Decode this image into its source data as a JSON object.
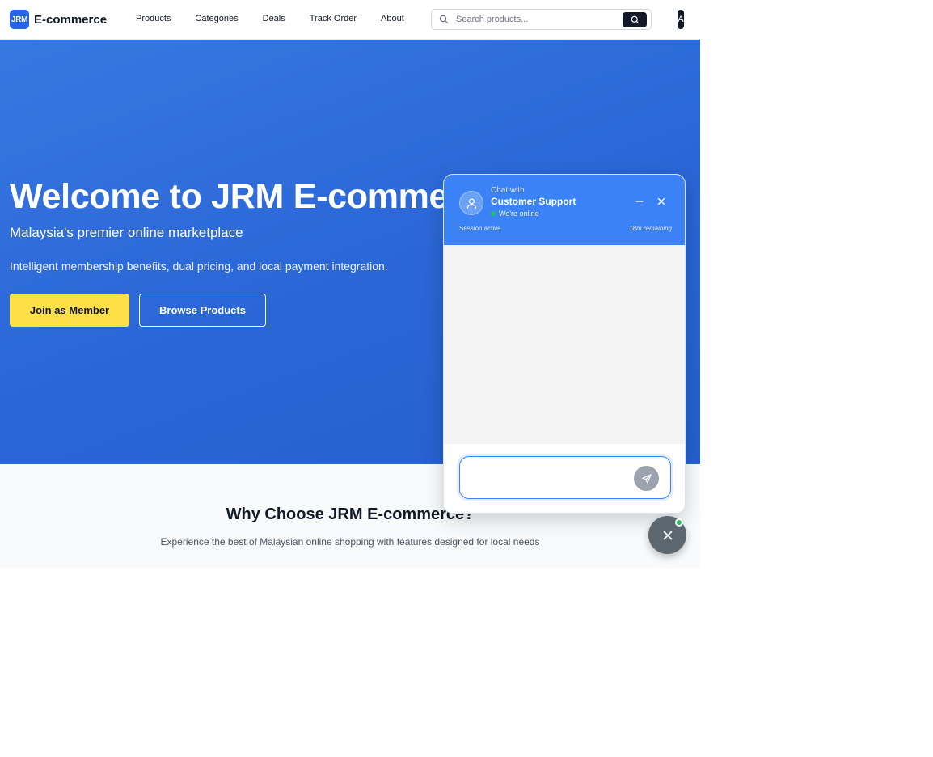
{
  "header": {
    "logo_badge": "JRM",
    "logo_text": "E-commerce",
    "nav": [
      "Products",
      "Categories",
      "Deals",
      "Track Order",
      "About"
    ],
    "search_placeholder": "Search products...",
    "avatar_initial": "A"
  },
  "hero": {
    "title": "Welcome to JRM E-commerce",
    "subtitle": "Malaysia's premier online marketplace",
    "description": "Intelligent membership benefits, dual pricing, and local payment integration.",
    "join_label": "Join as Member",
    "browse_label": "Browse Products"
  },
  "why": {
    "title": "Why Choose JRM E-commerce?",
    "subtitle": "Experience the best of Malaysian online shopping with features designed for local needs"
  },
  "chat": {
    "chat_with": "Chat with",
    "agent_name": "Customer Support",
    "status": "We're online",
    "session": "Session active",
    "remaining": "18m remaining",
    "input_value": ""
  },
  "colors": {
    "brand": "#2563eb",
    "hero_bg": "#2f6ddb",
    "accent_yellow": "#fde047",
    "chat_header": "#3b82f6",
    "online": "#22c55e"
  }
}
